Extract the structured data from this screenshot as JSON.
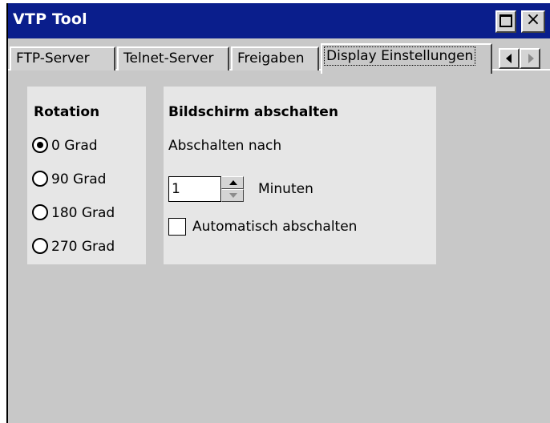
{
  "window": {
    "title": "VTP Tool"
  },
  "tabs": [
    {
      "label": "FTP-Server"
    },
    {
      "label": "Telnet-Server"
    },
    {
      "label": "Freigaben"
    },
    {
      "label": "Display Einstellungen"
    }
  ],
  "active_tab": "Display Einstellungen",
  "rotation": {
    "heading": "Rotation",
    "options": [
      {
        "label": "0 Grad",
        "selected": true
      },
      {
        "label": "90 Grad",
        "selected": false
      },
      {
        "label": "180 Grad",
        "selected": false
      },
      {
        "label": "270 Grad",
        "selected": false
      }
    ]
  },
  "screen_off": {
    "heading": "Bildschirm abschalten",
    "after_label": "Abschalten nach",
    "minutes_value": "1",
    "minutes_unit": "Minuten",
    "auto_off_label": "Automatisch abschalten",
    "auto_off_checked": false
  },
  "icons": {
    "maximize": "maximize-icon",
    "close": "close-icon",
    "tab_scroll_left": "chevron-left-icon",
    "tab_scroll_right": "chevron-right-icon",
    "spin_up": "spin-up-icon",
    "spin_down": "spin-down-icon"
  },
  "colors": {
    "titlebar": "#0a1e8c",
    "surface": "#c8c8c8",
    "panel": "#e6e6e6"
  }
}
